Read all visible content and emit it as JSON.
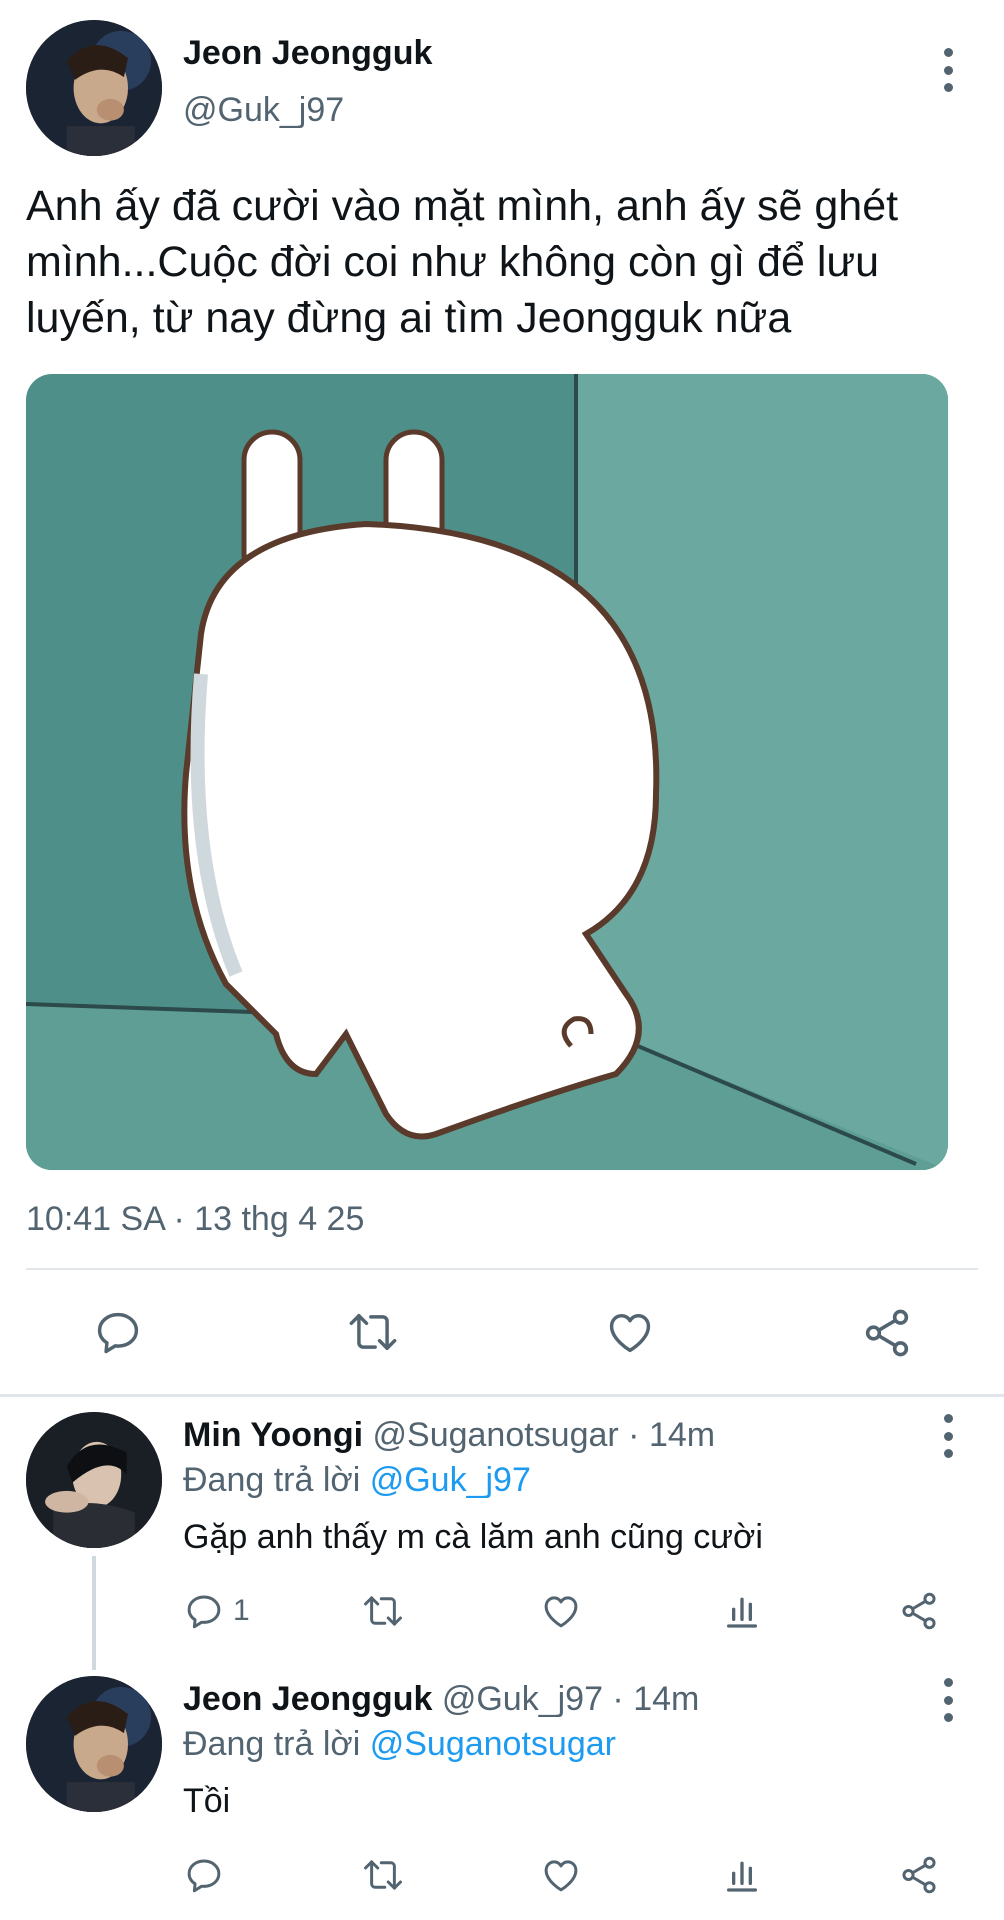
{
  "main_tweet": {
    "author_name": "Jeon Jeongguk",
    "handle": "@Guk_j97",
    "text": "Anh ấy đã cười vào mặt mình, anh ấy sẽ ghét mình...Cuộc đời coi như không còn gì để lưu luyến, từ nay đừng ai tìm Jeongguk nữa",
    "timestamp": "10:41 SA · 13 thg 4 25",
    "image_icon": "sad-white-bunny-sticker-icon"
  },
  "action_icons": [
    "reply-icon",
    "retweet-icon",
    "like-icon",
    "share-icon"
  ],
  "replies": [
    {
      "author_name": "Min Yoongi",
      "handle_time": "@Suganotsugar · 14m",
      "replying_prefix": "Đang trả lời",
      "replying_to": "@Guk_j97",
      "text": "Gặp anh thấy m cà lăm anh cũng cười",
      "reply_count": "1"
    },
    {
      "author_name": "Jeon Jeongguk",
      "handle_time": "@Guk_j97 · 14m",
      "replying_prefix": "Đang trả lời",
      "replying_to": "@Suganotsugar",
      "text": "Tồi",
      "reply_count": ""
    }
  ],
  "colors": {
    "accent": "#1d9bf0",
    "secondary_text": "#536471",
    "icon": "#536471"
  }
}
